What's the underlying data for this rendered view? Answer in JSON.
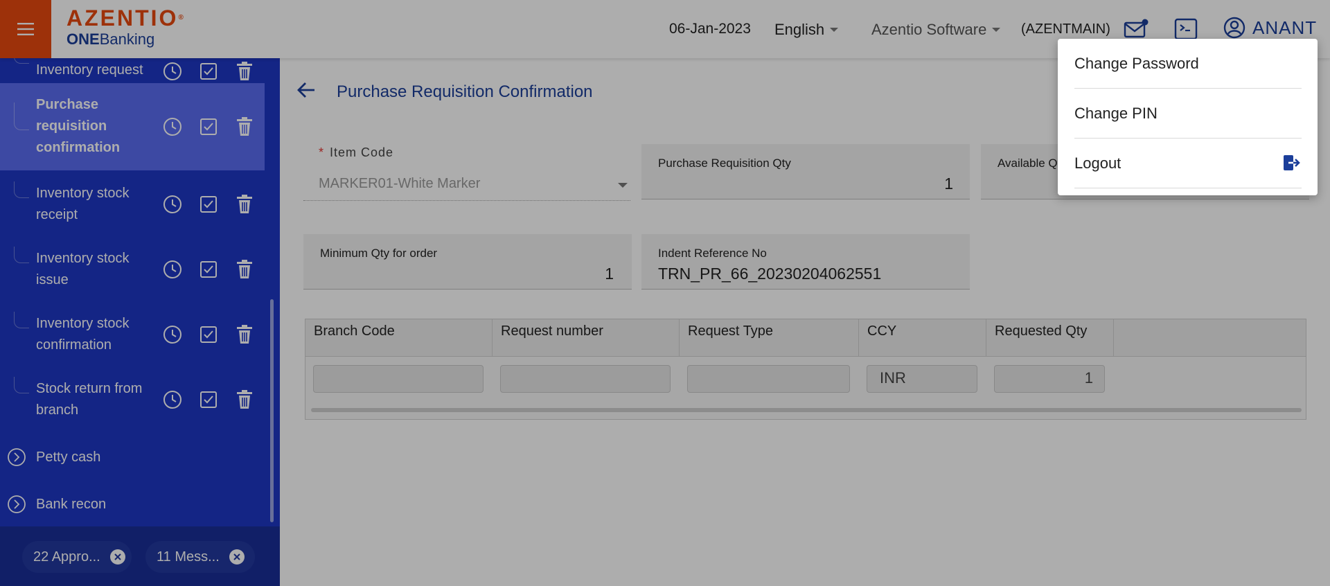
{
  "header": {
    "logo_main": "AZENTIO",
    "logo_tm": "®",
    "logo_sub_bold": "ONE",
    "logo_sub_rest": "Banking",
    "date": "06-Jan-2023",
    "language": "English",
    "organization": "Azentio Software",
    "branch": "(AZENTMAIN)",
    "user_name": "ANANT"
  },
  "sidebar": {
    "items": [
      {
        "label": "Inventory request"
      },
      {
        "label": "Purchase requisition confirmation",
        "selected": true
      },
      {
        "label": "Inventory stock receipt"
      },
      {
        "label": "Inventory stock issue"
      },
      {
        "label": "Inventory stock confirmation"
      },
      {
        "label": "Stock return from branch"
      }
    ],
    "groups": [
      {
        "label": "Petty cash"
      },
      {
        "label": "Bank recon"
      }
    ],
    "chips": [
      {
        "label": "22 Appro..."
      },
      {
        "label": "11 Mess..."
      }
    ]
  },
  "main": {
    "title": "Purchase Requisition Confirmation",
    "item_code": {
      "label": "Item Code",
      "value": "MARKER01-White Marker",
      "required_mark": "*"
    },
    "pr_qty": {
      "label": "Purchase Requisition Qty",
      "value": "1"
    },
    "available_qty": {
      "label": "Available Qt"
    },
    "min_qty": {
      "label": "Minimum Qty for order",
      "value": "1"
    },
    "indent_ref": {
      "label": "Indent Reference No",
      "value": "TRN_PR_66_20230204062551"
    },
    "grid": {
      "columns": [
        "Branch Code",
        "Request number",
        "Request Type",
        "CCY",
        "Requested Qty"
      ],
      "rows": [
        {
          "branch_code": "",
          "request_number": "",
          "request_type": "",
          "ccy": "INR",
          "requested_qty": "1"
        }
      ]
    }
  },
  "user_menu": {
    "items": [
      {
        "label": "Change Password"
      },
      {
        "label": "Change PIN"
      },
      {
        "label": "Logout"
      }
    ]
  },
  "colors": {
    "brand_orange": "#e8490f",
    "brand_blue": "#1b3e9a",
    "sidebar_bg": "#1e37c4",
    "sidebar_selected": "#5b6cf0"
  }
}
